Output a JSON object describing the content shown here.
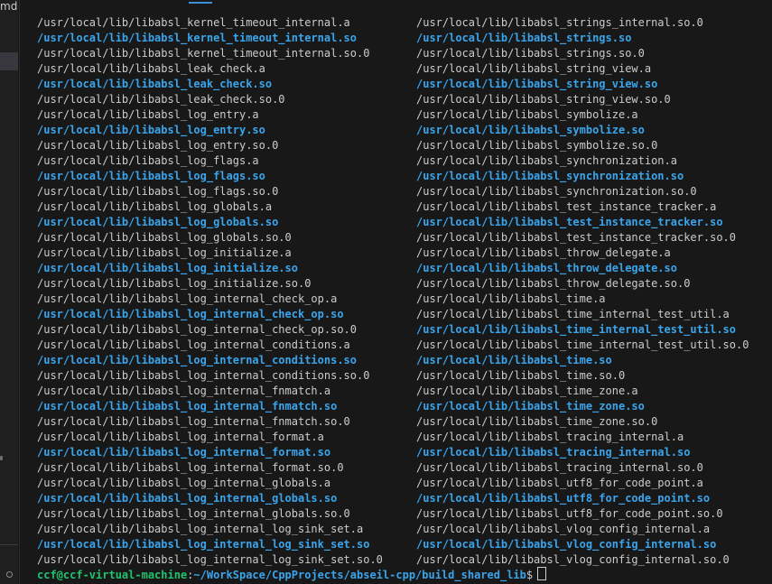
{
  "explorer": {
    "fragment_text": "md"
  },
  "colors": {
    "background": "#181818",
    "text": "#cccccc",
    "symlink": "#3aa5ec",
    "user_host": "#1ec46e"
  },
  "terminal": {
    "left_column": [
      {
        "text": "/usr/local/lib/libabsl_kernel_timeout_internal.a",
        "kind": "file"
      },
      {
        "text": "/usr/local/lib/libabsl_kernel_timeout_internal.so",
        "kind": "symlink"
      },
      {
        "text": "/usr/local/lib/libabsl_kernel_timeout_internal.so.0",
        "kind": "file"
      },
      {
        "text": "/usr/local/lib/libabsl_leak_check.a",
        "kind": "file"
      },
      {
        "text": "/usr/local/lib/libabsl_leak_check.so",
        "kind": "symlink"
      },
      {
        "text": "/usr/local/lib/libabsl_leak_check.so.0",
        "kind": "file"
      },
      {
        "text": "/usr/local/lib/libabsl_log_entry.a",
        "kind": "file"
      },
      {
        "text": "/usr/local/lib/libabsl_log_entry.so",
        "kind": "symlink"
      },
      {
        "text": "/usr/local/lib/libabsl_log_entry.so.0",
        "kind": "file"
      },
      {
        "text": "/usr/local/lib/libabsl_log_flags.a",
        "kind": "file"
      },
      {
        "text": "/usr/local/lib/libabsl_log_flags.so",
        "kind": "symlink"
      },
      {
        "text": "/usr/local/lib/libabsl_log_flags.so.0",
        "kind": "file"
      },
      {
        "text": "/usr/local/lib/libabsl_log_globals.a",
        "kind": "file"
      },
      {
        "text": "/usr/local/lib/libabsl_log_globals.so",
        "kind": "symlink"
      },
      {
        "text": "/usr/local/lib/libabsl_log_globals.so.0",
        "kind": "file"
      },
      {
        "text": "/usr/local/lib/libabsl_log_initialize.a",
        "kind": "file"
      },
      {
        "text": "/usr/local/lib/libabsl_log_initialize.so",
        "kind": "symlink"
      },
      {
        "text": "/usr/local/lib/libabsl_log_initialize.so.0",
        "kind": "file"
      },
      {
        "text": "/usr/local/lib/libabsl_log_internal_check_op.a",
        "kind": "file"
      },
      {
        "text": "/usr/local/lib/libabsl_log_internal_check_op.so",
        "kind": "symlink"
      },
      {
        "text": "/usr/local/lib/libabsl_log_internal_check_op.so.0",
        "kind": "file"
      },
      {
        "text": "/usr/local/lib/libabsl_log_internal_conditions.a",
        "kind": "file"
      },
      {
        "text": "/usr/local/lib/libabsl_log_internal_conditions.so",
        "kind": "symlink"
      },
      {
        "text": "/usr/local/lib/libabsl_log_internal_conditions.so.0",
        "kind": "file"
      },
      {
        "text": "/usr/local/lib/libabsl_log_internal_fnmatch.a",
        "kind": "file"
      },
      {
        "text": "/usr/local/lib/libabsl_log_internal_fnmatch.so",
        "kind": "symlink"
      },
      {
        "text": "/usr/local/lib/libabsl_log_internal_fnmatch.so.0",
        "kind": "file"
      },
      {
        "text": "/usr/local/lib/libabsl_log_internal_format.a",
        "kind": "file"
      },
      {
        "text": "/usr/local/lib/libabsl_log_internal_format.so",
        "kind": "symlink"
      },
      {
        "text": "/usr/local/lib/libabsl_log_internal_format.so.0",
        "kind": "file"
      },
      {
        "text": "/usr/local/lib/libabsl_log_internal_globals.a",
        "kind": "file"
      },
      {
        "text": "/usr/local/lib/libabsl_log_internal_globals.so",
        "kind": "symlink"
      },
      {
        "text": "/usr/local/lib/libabsl_log_internal_globals.so.0",
        "kind": "file"
      },
      {
        "text": "/usr/local/lib/libabsl_log_internal_log_sink_set.a",
        "kind": "file"
      },
      {
        "text": "/usr/local/lib/libabsl_log_internal_log_sink_set.so",
        "kind": "symlink"
      },
      {
        "text": "/usr/local/lib/libabsl_log_internal_log_sink_set.so.0",
        "kind": "file"
      }
    ],
    "right_column": [
      {
        "text": "/usr/local/lib/libabsl_strings_internal.so.0",
        "kind": "file"
      },
      {
        "text": "/usr/local/lib/libabsl_strings.so",
        "kind": "symlink"
      },
      {
        "text": "/usr/local/lib/libabsl_strings.so.0",
        "kind": "file"
      },
      {
        "text": "/usr/local/lib/libabsl_string_view.a",
        "kind": "file"
      },
      {
        "text": "/usr/local/lib/libabsl_string_view.so",
        "kind": "symlink"
      },
      {
        "text": "/usr/local/lib/libabsl_string_view.so.0",
        "kind": "file"
      },
      {
        "text": "/usr/local/lib/libabsl_symbolize.a",
        "kind": "file"
      },
      {
        "text": "/usr/local/lib/libabsl_symbolize.so",
        "kind": "symlink"
      },
      {
        "text": "/usr/local/lib/libabsl_symbolize.so.0",
        "kind": "file"
      },
      {
        "text": "/usr/local/lib/libabsl_synchronization.a",
        "kind": "file"
      },
      {
        "text": "/usr/local/lib/libabsl_synchronization.so",
        "kind": "symlink"
      },
      {
        "text": "/usr/local/lib/libabsl_synchronization.so.0",
        "kind": "file"
      },
      {
        "text": "/usr/local/lib/libabsl_test_instance_tracker.a",
        "kind": "file"
      },
      {
        "text": "/usr/local/lib/libabsl_test_instance_tracker.so",
        "kind": "symlink"
      },
      {
        "text": "/usr/local/lib/libabsl_test_instance_tracker.so.0",
        "kind": "file"
      },
      {
        "text": "/usr/local/lib/libabsl_throw_delegate.a",
        "kind": "file"
      },
      {
        "text": "/usr/local/lib/libabsl_throw_delegate.so",
        "kind": "symlink"
      },
      {
        "text": "/usr/local/lib/libabsl_throw_delegate.so.0",
        "kind": "file"
      },
      {
        "text": "/usr/local/lib/libabsl_time.a",
        "kind": "file"
      },
      {
        "text": "/usr/local/lib/libabsl_time_internal_test_util.a",
        "kind": "file"
      },
      {
        "text": "/usr/local/lib/libabsl_time_internal_test_util.so",
        "kind": "symlink"
      },
      {
        "text": "/usr/local/lib/libabsl_time_internal_test_util.so.0",
        "kind": "file"
      },
      {
        "text": "/usr/local/lib/libabsl_time.so",
        "kind": "symlink"
      },
      {
        "text": "/usr/local/lib/libabsl_time.so.0",
        "kind": "file"
      },
      {
        "text": "/usr/local/lib/libabsl_time_zone.a",
        "kind": "file"
      },
      {
        "text": "/usr/local/lib/libabsl_time_zone.so",
        "kind": "symlink"
      },
      {
        "text": "/usr/local/lib/libabsl_time_zone.so.0",
        "kind": "file"
      },
      {
        "text": "/usr/local/lib/libabsl_tracing_internal.a",
        "kind": "file"
      },
      {
        "text": "/usr/local/lib/libabsl_tracing_internal.so",
        "kind": "symlink"
      },
      {
        "text": "/usr/local/lib/libabsl_tracing_internal.so.0",
        "kind": "file"
      },
      {
        "text": "/usr/local/lib/libabsl_utf8_for_code_point.a",
        "kind": "file"
      },
      {
        "text": "/usr/local/lib/libabsl_utf8_for_code_point.so",
        "kind": "symlink"
      },
      {
        "text": "/usr/local/lib/libabsl_utf8_for_code_point.so.0",
        "kind": "file"
      },
      {
        "text": "/usr/local/lib/libabsl_vlog_config_internal.a",
        "kind": "file"
      },
      {
        "text": "/usr/local/lib/libabsl_vlog_config_internal.so",
        "kind": "symlink"
      },
      {
        "text": "/usr/local/lib/libabsl_vlog_config_internal.so.0",
        "kind": "file"
      }
    ],
    "prompt": {
      "user_host": "ccf@ccf-virtual-machine",
      "separator": ":",
      "path": "~/WorkSpace/CppProjects/abseil-cpp/build_shared_lib",
      "symbol": "$"
    }
  }
}
